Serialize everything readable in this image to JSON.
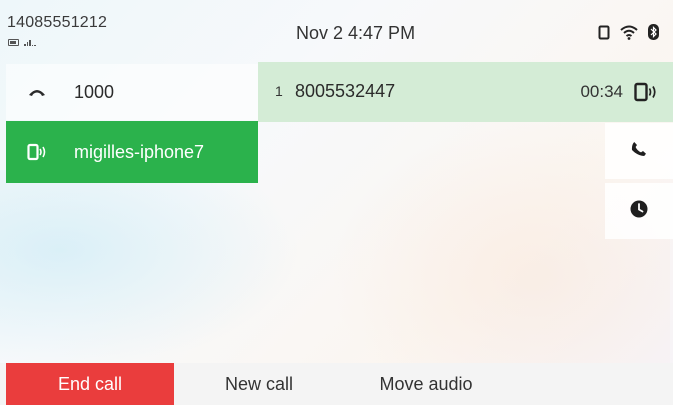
{
  "line": {
    "number": "14085551212"
  },
  "status": {
    "datetime": "Nov 2 4:47 PM",
    "icons": [
      "phone-device-icon",
      "wifi-icon",
      "bluetooth-icon"
    ]
  },
  "sessions": [
    {
      "label": "1000",
      "icon": "handset-icon",
      "active": false
    },
    {
      "label": "migilles-iphone7",
      "icon": "mobile-device-icon",
      "active": true,
      "color": "#2bb24c"
    }
  ],
  "active_call": {
    "index": "1",
    "number": "8005532447",
    "duration": "00:34",
    "icon": "mobile-device-icon",
    "color": "#d4ecd6"
  },
  "side_actions": [
    {
      "icon": "phone-icon"
    },
    {
      "icon": "recents-clock-icon"
    }
  ],
  "softkeys": {
    "end_call": "End call",
    "new_call": "New call",
    "move_audio": "Move audio",
    "end_call_color": "#ea3d3d"
  }
}
